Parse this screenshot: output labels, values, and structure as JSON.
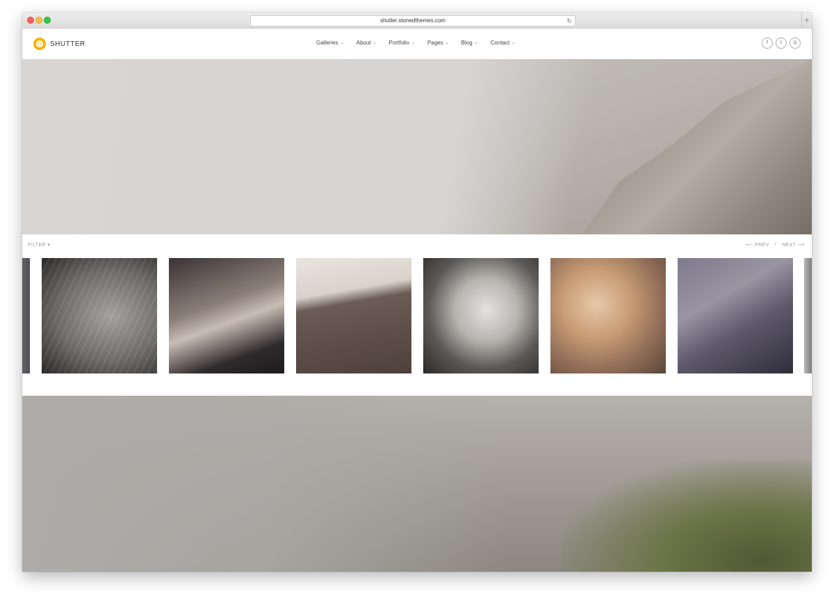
{
  "browser": {
    "url": "shutter.stonedthemes.com",
    "reload_icon": "reload-icon",
    "new_tab_glyph": "+"
  },
  "header": {
    "logo_text": "SHUTTER",
    "logo_icon": "aperture-logo-icon",
    "nav": [
      {
        "label": "Galleries"
      },
      {
        "label": "About"
      },
      {
        "label": "Portfolio"
      },
      {
        "label": "Pages"
      },
      {
        "label": "Blog"
      },
      {
        "label": "Contact"
      }
    ],
    "social": [
      {
        "icon": "facebook-icon",
        "glyph": "f"
      },
      {
        "icon": "twitter-icon",
        "glyph": "t"
      },
      {
        "icon": "instagram-icon",
        "glyph": "◎"
      }
    ]
  },
  "gallery": {
    "filter_label": "FILTER ▾",
    "prev_label": "⟵ PREV",
    "separator": "/",
    "next_label": "NEXT ⟶"
  },
  "colors": {
    "accent": "#f4b400",
    "text": "#444444",
    "muted": "#999999"
  }
}
